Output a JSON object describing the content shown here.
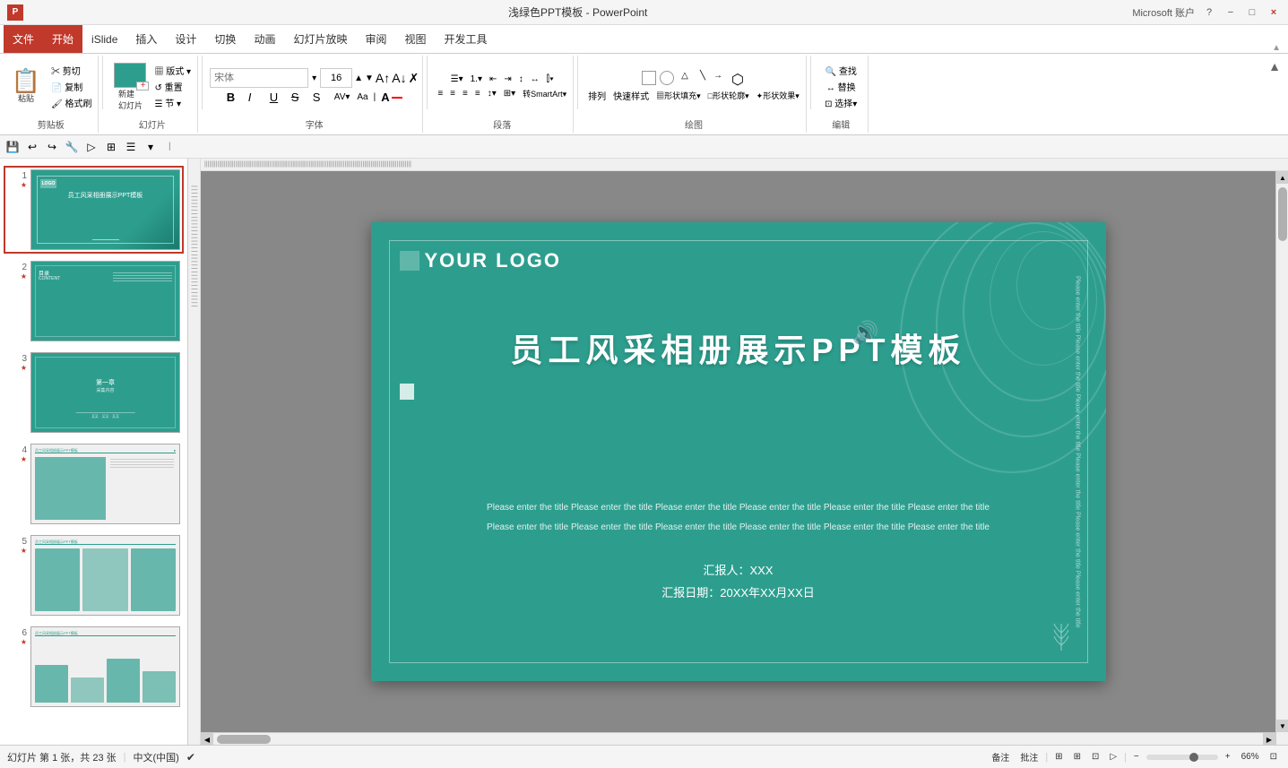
{
  "titlebar": {
    "app_title": "浅绿色PPT模板 - PowerPoint",
    "ppt_icon": "P",
    "account": "Microsoft 账户",
    "win_min": "−",
    "win_restore": "□",
    "win_close": "×",
    "help": "?"
  },
  "ribbon": {
    "tabs": [
      "文件",
      "开始",
      "iSlide",
      "插入",
      "设计",
      "切换",
      "动画",
      "幻灯片放映",
      "审阅",
      "视图",
      "开发工具"
    ],
    "active_tab": "开始",
    "groups": {
      "clipboard": {
        "label": "剪贴板",
        "items": [
          "粘贴",
          "剪切",
          "复制",
          "格式刷"
        ]
      },
      "slides": {
        "label": "幻灯片",
        "items": [
          "新建幻灯片",
          "版式",
          "重置",
          "节"
        ]
      },
      "font": {
        "label": "字体",
        "font_name": "",
        "font_size": "16",
        "bold": "B",
        "italic": "I",
        "underline": "U",
        "strikethrough": "S"
      },
      "paragraph": {
        "label": "段落"
      },
      "drawing": {
        "label": "绘图"
      },
      "editing": {
        "label": "编辑",
        "items": [
          "查找",
          "替换",
          "选择"
        ]
      }
    }
  },
  "quick_toolbar": {
    "items": [
      "💾",
      "↩",
      "↪",
      "🔧",
      "□",
      "☰",
      "▾"
    ]
  },
  "slides": [
    {
      "num": "1",
      "star": "★",
      "type": "cover",
      "title": "员工风采相册展示PPT模板",
      "logo": "YOUR LOGO"
    },
    {
      "num": "2",
      "star": "★",
      "type": "content",
      "title": "目录 CONTENT"
    },
    {
      "num": "3",
      "star": "★",
      "type": "section",
      "title": "第一章 采集内容"
    },
    {
      "num": "4",
      "star": "★",
      "type": "content2"
    },
    {
      "num": "5",
      "star": "★",
      "type": "photos"
    },
    {
      "num": "6",
      "star": "★",
      "type": "infographic"
    }
  ],
  "main_slide": {
    "logo_text": "YOUR LOGO",
    "title": "员工风采相册展示PPT模板",
    "description_line1": "Please enter the title Please enter the title Please enter the title Please enter the title Please enter the title Please enter the title",
    "description_line2": "Please enter the title Please enter the title Please enter the title Please enter the title Please enter the title Please enter the title",
    "reporter_label": "汇报人：XXX",
    "date_label": "汇报日期：20XX年XX月XX日",
    "vertical_text": "Please enter the title Please enter the title Please enter the title Please enter the title Please enter the title Please enter the title"
  },
  "statusbar": {
    "slide_info": "幻灯片 第 1 张，共 23 张",
    "lang": "中文(中国)",
    "notes": "备注",
    "comments": "批注",
    "view_normal": "▦",
    "view_slide": "⊞",
    "view_reading": "📖",
    "zoom": "66%",
    "zoom_out": "−",
    "zoom_in": "+"
  }
}
